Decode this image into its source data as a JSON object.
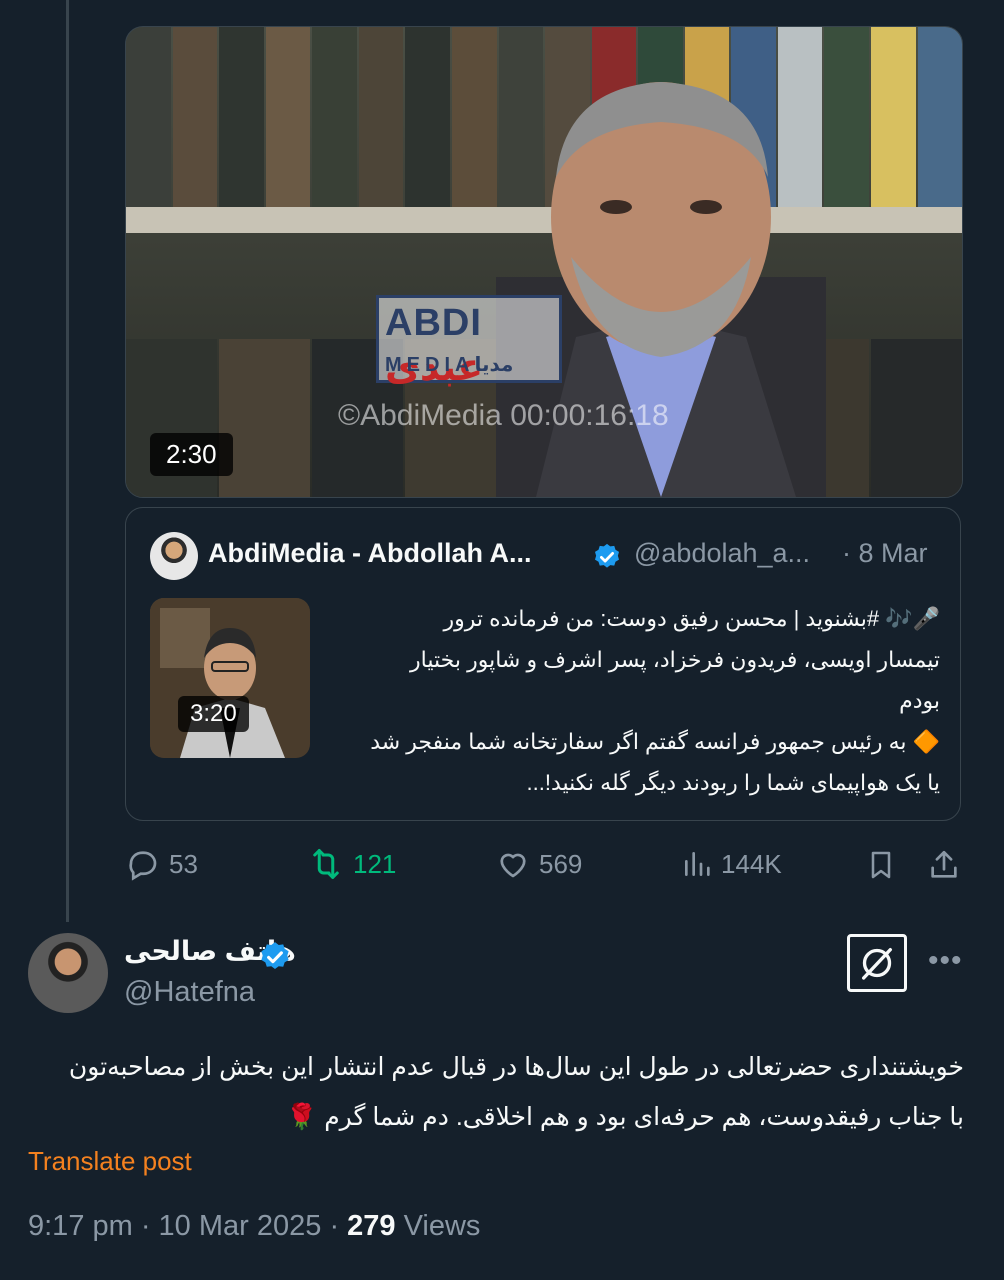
{
  "media": {
    "duration": "2:30",
    "watermark_logo_latin": "ABDI",
    "watermark_logo_arabic": "عبدی",
    "watermark_sub": "MEDIA",
    "watermark_sub_arabic": "مديا",
    "watermark_timestamp": "©AbdiMedia 00:00:16:18"
  },
  "quote": {
    "author_name": "AbdiMedia - Abdollah A...",
    "handle": "@abdolah_a...",
    "date": "· 8 Mar",
    "thumb_duration": "3:20",
    "lines": [
      "🎤🎶 #بشنوید | محسن رفیق دوست: من فرمانده ترور",
      "تیمسار اویسی، فریدون فرخزاد، پسر اشرف و شاپور بختیار",
      "بودم",
      "🔶 به رئیس جمهور فرانسه گفتم اگر سفارتخانه شما منفجر شد",
      "یا یک هواپیمای شما را ربودند دیگر گله نکنید!..."
    ]
  },
  "actions": {
    "replies": "53",
    "reposts": "121",
    "likes": "569",
    "views": "144K"
  },
  "post": {
    "author_name": "هاتف صالحی",
    "handle": "@Hatefna",
    "lines": [
      "خویشتنداری حضرتعالی در طول این سال‌ها در قبال عدم انتشار این بخش از مصاحبه‌تون",
      "با جناب رفیقدوست، هم حرفه‌ای بود و هم اخلاقی. دم شما گرم 🌹"
    ],
    "translate_label": "Translate post",
    "time": "9:17 pm · 10 Mar 2025 · ",
    "views_count": "279",
    "views_label": " Views"
  },
  "colors": {
    "background": "#15202b",
    "muted": "#8b98a5",
    "verified": "#1d9bf0",
    "repost": "#00ba7c",
    "translate": "#f4811f"
  }
}
